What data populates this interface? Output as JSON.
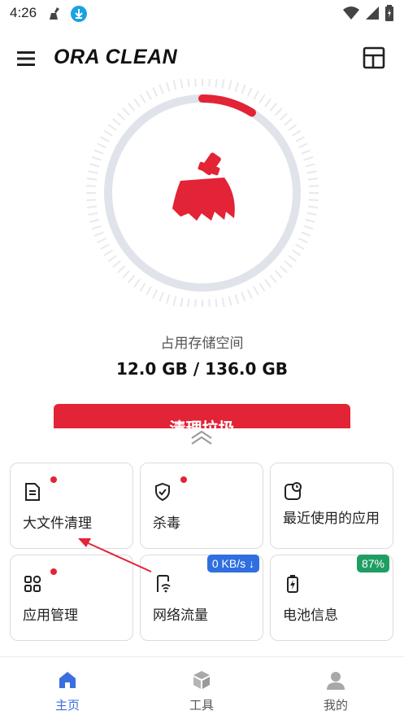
{
  "status": {
    "time": "4:26",
    "icons": [
      "broom-notification-icon",
      "download-notification-icon",
      "wifi-icon",
      "signal-icon",
      "battery-icon"
    ]
  },
  "appbar": {
    "title": "ORA CLEAN",
    "menu_icon": "hamburger-menu-icon",
    "layout_icon": "layout-grid-icon"
  },
  "gauge": {
    "icon": "broom-icon",
    "usage_fraction": 0.088,
    "accent": "#e32336",
    "track": "#e1e3ea"
  },
  "storage": {
    "label": "占用存储空间",
    "value": "12.0 GB / 136.0 GB"
  },
  "clean_button": {
    "label": "清理垃圾"
  },
  "tiles": [
    {
      "label": "大文件清理",
      "icon": "document-icon",
      "dot": true
    },
    {
      "label": "杀毒",
      "icon": "shield-check-icon",
      "dot": true
    },
    {
      "label": "最近使用的应用",
      "icon": "recent-clock-icon",
      "dot": true
    },
    {
      "label": "应用管理",
      "icon": "apps-grid-icon",
      "dot": true
    },
    {
      "label": "网络流量",
      "icon": "network-phone-icon",
      "badge": "0 KB/s ↓",
      "badge_color": "#2f6fe0"
    },
    {
      "label": "电池信息",
      "icon": "battery-charging-icon",
      "badge": "87%",
      "badge_color": "#1f9d63"
    }
  ],
  "bottom_nav": [
    {
      "label": "主页",
      "icon": "home-icon",
      "active": true
    },
    {
      "label": "工具",
      "icon": "toolbox-cube-icon",
      "active": false
    },
    {
      "label": "我的",
      "icon": "profile-icon",
      "active": false
    }
  ],
  "colors": {
    "accent_red": "#e32336",
    "nav_active": "#3b6fe0",
    "nav_inactive": "#9a9a9a"
  }
}
